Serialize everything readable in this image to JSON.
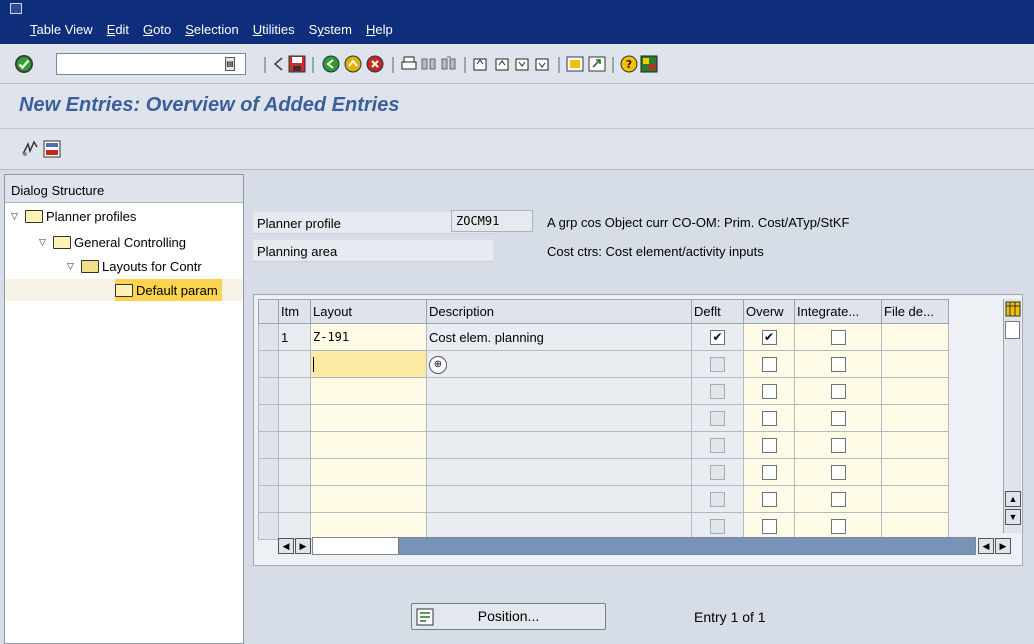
{
  "menu": [
    "Table View",
    "Edit",
    "Goto",
    "Selection",
    "Utilities",
    "System",
    "Help"
  ],
  "menu_mnemonics": [
    "T",
    "E",
    "G",
    "S",
    "U",
    "y",
    "H"
  ],
  "command_field": {
    "value": ""
  },
  "page_title": "New Entries: Overview of Added Entries",
  "dialog_structure": {
    "heading": "Dialog Structure",
    "items": [
      {
        "label": "Planner profiles",
        "level": 0,
        "expanded": true
      },
      {
        "label": "General Controlling",
        "level": 1,
        "expanded": true
      },
      {
        "label": "Layouts for Contr",
        "level": 2,
        "expanded": true
      },
      {
        "label": "Default param",
        "level": 3,
        "selected": true
      }
    ]
  },
  "header": {
    "planner_profile_label": "Planner profile",
    "planner_profile_value": "ZOCM91",
    "planner_profile_desc": "A grp cos Object curr  CO-OM: Prim. Cost/ATyp/StKF",
    "planning_area_label": "Planning area",
    "planning_area_desc": "Cost ctrs: Cost element/activity inputs"
  },
  "table": {
    "columns": [
      "Itm",
      "Layout",
      "Description",
      "Deflt",
      "Overw",
      "Integrate...",
      "File de..."
    ],
    "rows": [
      {
        "itm": "1",
        "layout": "Z-191",
        "description": "Cost elem. planning",
        "deflt": true,
        "overw": true,
        "integrate": false,
        "file": ""
      }
    ],
    "empty_rows": 7
  },
  "position_button": "Position...",
  "entry_info": "Entry 1 of 1",
  "colors": {
    "menubar": "#0e2d7a",
    "title": "#3b5f98",
    "input_bg": "#fffbe6",
    "cursor_cell": "#fce9a4"
  }
}
